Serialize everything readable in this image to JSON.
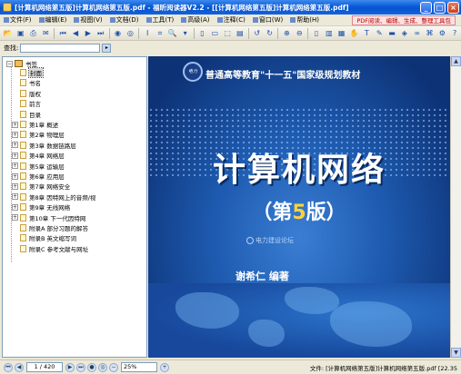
{
  "window": {
    "title": "[计算机网络第五版]计算机网络第五版.pdf - 福昕阅读器V2.2 - [[计算机网络第五版]计算机网络第五版.pdf]",
    "buttons": [
      "_",
      "□",
      "×"
    ]
  },
  "menu": {
    "items": [
      "文件(F)",
      "编辑(E)",
      "视图(V)",
      "文档(D)",
      "工具(T)",
      "高级(A)",
      "注释(C)",
      "窗口(W)",
      "帮助(H)"
    ],
    "promo": "PDF阅读、编辑、生成、整理工具包"
  },
  "search": {
    "label": "查找:",
    "value": ""
  },
  "outline": {
    "root": "书签",
    "items": [
      {
        "label": "封面",
        "expandable": false,
        "selected": true
      },
      {
        "label": "书名",
        "expandable": false
      },
      {
        "label": "版权",
        "expandable": false
      },
      {
        "label": "前言",
        "expandable": false
      },
      {
        "label": "目录",
        "expandable": false
      },
      {
        "label": "第1章 概述",
        "expandable": true
      },
      {
        "label": "第2章 物理层",
        "expandable": true
      },
      {
        "label": "第3章 数据链路层",
        "expandable": true
      },
      {
        "label": "第4章 网络层",
        "expandable": true
      },
      {
        "label": "第5章 运输层",
        "expandable": true
      },
      {
        "label": "第6章 应用层",
        "expandable": true
      },
      {
        "label": "第7章 网络安全",
        "expandable": true
      },
      {
        "label": "第8章 因特网上的音频/视",
        "expandable": true
      },
      {
        "label": "第9章 无线网络",
        "expandable": true
      },
      {
        "label": "第10章 下一代因特网",
        "expandable": true
      },
      {
        "label": "附录A 部分习题的解答",
        "expandable": false
      },
      {
        "label": "附录B 英文缩写词",
        "expandable": false
      },
      {
        "label": "附录C 参考文献与网址",
        "expandable": false
      }
    ]
  },
  "cover": {
    "publisher_logo": "电力",
    "series": "普通高等教育\"十一五\"国家级规划教材",
    "title": "计算机网络",
    "edition_open": "（第",
    "edition_num": "5",
    "edition_close": "版）",
    "watermark": "电力建设论坛",
    "author": "谢希仁  编著"
  },
  "statusbar": {
    "page": "1 / 420",
    "zoom": "25%",
    "file": "文件: [计算机网络第五版]计算机网络第五版.pdf [22.35"
  }
}
